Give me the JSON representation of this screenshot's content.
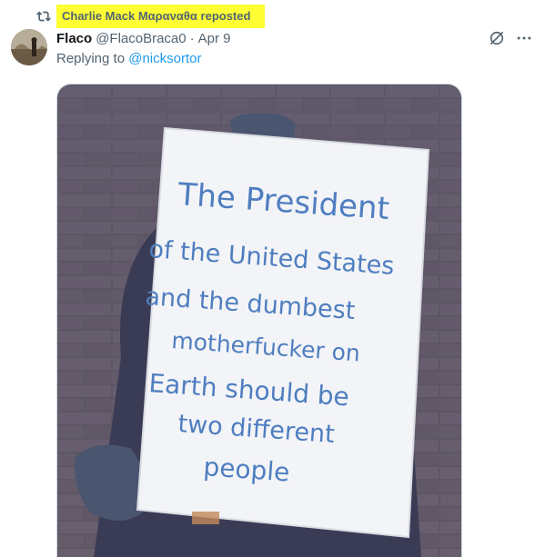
{
  "repost": {
    "reposter_name": "Charlie Mack Μαραναθα",
    "suffix": " reposted",
    "highlight_color": "#ffff33"
  },
  "tweet": {
    "display_name": "Flaco",
    "handle": "@FlacoBraca0",
    "separator": "·",
    "date": "Apr 9",
    "replying_prefix": "Replying to ",
    "replying_to": "@nicksortor",
    "icons": {
      "repost": "repost-icon",
      "grok": "grok-icon",
      "more": "more-icon"
    }
  },
  "media": {
    "sign_lines": [
      "The President",
      "of the United States",
      "and the dumbest",
      "motherfucker on",
      "Earth should be",
      "two different",
      "people"
    ]
  },
  "colors": {
    "accent": "#1d9bf0",
    "secondary_text": "#536471",
    "primary_text": "#0f1419",
    "sign_ink": "#4f7ec0"
  }
}
